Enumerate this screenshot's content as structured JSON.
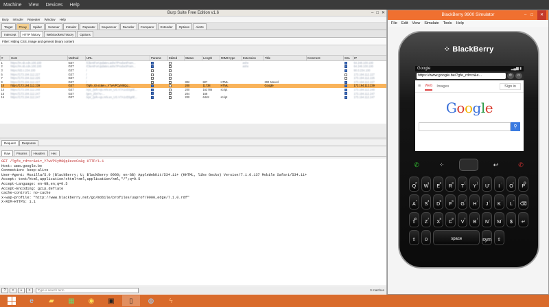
{
  "vbox_menu": [
    "Machine",
    "View",
    "Devices",
    "Help"
  ],
  "burp": {
    "title": "Burp Suite Free Edition v1.6",
    "menu": [
      "Burp",
      "Intruder",
      "Repeater",
      "Window",
      "Help"
    ],
    "main_tabs": [
      "Target",
      "Proxy",
      "Spider",
      "Scanner",
      "Intruder",
      "Repeater",
      "Sequencer",
      "Decoder",
      "Comparer",
      "Extender",
      "Options",
      "Alerts"
    ],
    "proxy_tabs": [
      "Intercept",
      "HTTP history",
      "WebSockets history",
      "Options"
    ],
    "filter": "Filter: Hiding CSS, image and general binary content",
    "columns": [
      "#",
      "Host",
      "Method",
      "URL",
      "Params",
      "Edited",
      "Status",
      "Length",
      "MIME type",
      "Extension",
      "Title",
      "Comment",
      "SSL",
      "IP"
    ],
    "rows": [
      {
        "num": "1",
        "host": "https://m.sb.cdn.100.100",
        "method": "GET",
        "url": "/ClientForUpdates.ashx?ProductFram...",
        "params": true,
        "edited": false,
        "status": "",
        "length": "",
        "mime": "",
        "ext": "ashx",
        "title": "",
        "ssl": true,
        "ip": "64.248.100.100"
      },
      {
        "num": "2",
        "host": "https://m.sb.cdn.100.100",
        "method": "GET",
        "url": "/ClientForUpdates.ashx?ProductFram...",
        "params": true,
        "edited": false,
        "status": "",
        "length": "",
        "mime": "",
        "ext": "ashx",
        "title": "",
        "ssl": true,
        "ip": "64.248.100.100"
      },
      {
        "num": "3",
        "host": "https://d2.c.234.100",
        "method": "GET",
        "url": "/",
        "params": false,
        "edited": false,
        "status": "",
        "length": "",
        "mime": "",
        "ext": "",
        "title": "",
        "ssl": true,
        "ip": "90.0.234.100"
      },
      {
        "num": "5",
        "host": "https://173.194.112.227",
        "method": "GET",
        "url": "/",
        "params": false,
        "edited": false,
        "status": "",
        "length": "",
        "mime": "",
        "ext": "",
        "title": "",
        "ssl": false,
        "ip": "173.194.112.227"
      },
      {
        "num": "7",
        "host": "https://173.194.112.226",
        "method": "GET",
        "url": "/",
        "params": false,
        "edited": false,
        "status": "",
        "length": "",
        "mime": "",
        "ext": "",
        "title": "",
        "ssl": false,
        "ip": "173.194.112.226"
      },
      {
        "num": "9",
        "host": "https://173.194.112.227",
        "method": "GET",
        "url": "/",
        "params": false,
        "edited": false,
        "status": "302",
        "length": "827",
        "mime": "HTML",
        "ext": "",
        "title": "302 Moved",
        "ssl": true,
        "ip": "173.194.112.227"
      },
      {
        "num": "10",
        "host": "https://173.194.112.239",
        "method": "GET",
        "url": "/?gfe_rd=cr&ei=_Y7wVPCyM8Qq...",
        "params": true,
        "edited": false,
        "status": "200",
        "length": "11738",
        "mime": "HTML",
        "ext": "",
        "title": "Google",
        "ssl": true,
        "ip": "173.194.112.239",
        "selected": true
      },
      {
        "num": "14",
        "host": "https://173.194.112.248",
        "method": "GET",
        "url": "/xjs/_/js/k=xjs.mhi.en_US.V7A1cE0g0E...",
        "params": true,
        "edited": false,
        "status": "200",
        "length": "163786",
        "mime": "script",
        "ext": "",
        "title": "",
        "ssl": true,
        "ip": "173.194.112.248"
      },
      {
        "num": "15",
        "host": "https://173.194.112.247",
        "method": "GET",
        "url": "/gen_204?s=...",
        "params": true,
        "edited": false,
        "status": "204",
        "length": "168",
        "mime": "",
        "ext": "",
        "title": "",
        "ssl": true,
        "ip": "173.194.112.247"
      },
      {
        "num": "16",
        "host": "https://173.194.112.247",
        "method": "GET",
        "url": "/xjs/_/js/k=xjs.mhi.en_US.V7A1cE0g0E...",
        "params": true,
        "edited": false,
        "status": "200",
        "length": "6448",
        "mime": "script",
        "ext": "",
        "title": "",
        "ssl": true,
        "ip": "173.194.112.247"
      }
    ],
    "req_tabs": [
      "Request",
      "Response"
    ],
    "raw_tabs": [
      "Raw",
      "Params",
      "Headers",
      "Hex"
    ],
    "request_lines": [
      {
        "text": "GET /?gfe_rd=cr&ei=_Y7wVPCyM8Qq8ezoCo&g HTTP/1.1",
        "hl": true
      },
      {
        "text": "Host: www.google.be",
        "hl": false
      },
      {
        "text": "Connection: keep-alive",
        "hl": false
      },
      {
        "text": "User-Agent: Mozilla/5.0 (BlackBerry; U; BlackBerry 9900; en-GB) AppleWebKit/534.11+ (KHTML, like Gecko) Version/7.1.0.137 Mobile Safari/534.11+",
        "hl": false
      },
      {
        "text": "Accept: text/html,application/xhtml+xml,application/xml,*/*;q=0.5",
        "hl": false
      },
      {
        "text": "Accept-Language: en-GB,en;q=0.5",
        "hl": false
      },
      {
        "text": "Accept-Encoding: gzip,deflate",
        "hl": false
      },
      {
        "text": "cache-control: no-cache",
        "hl": false
      },
      {
        "text": "x-wap-profile: \"http://www.blackberry.net/go/mobile/profiles/uaprof/9900_edge/7.1.0.rdf\"",
        "hl": false
      },
      {
        "text": "X-RIM-HTTPS: 1.1",
        "hl": false
      }
    ],
    "search_buttons": [
      "?",
      "<",
      "+",
      ">"
    ],
    "search_placeholder": "Type a search term",
    "matches": "0 matches"
  },
  "simulator": {
    "title": "BlackBerry 9900 Simulator",
    "menu": [
      "File",
      "Edit",
      "View",
      "Simulate",
      "Tools",
      "Help"
    ],
    "brand": "BlackBerry",
    "browser_title": "Google",
    "url": "https://www.google.be/?gfe_rd=cr&e...",
    "google_tabs": {
      "web": "Web",
      "images": "Images",
      "signin": "Sign in"
    },
    "google_logo": [
      "G",
      "o",
      "o",
      "g",
      "l",
      "e"
    ],
    "google_logo_colors": [
      "#3a6fd8",
      "#d8392b",
      "#f4b400",
      "#3a6fd8",
      "#2b9a46",
      "#d8392b"
    ],
    "keys": [
      {
        "main": "Q",
        "alt": "#"
      },
      {
        "main": "W",
        "alt": "1"
      },
      {
        "main": "E",
        "alt": "2"
      },
      {
        "main": "R",
        "alt": "3"
      },
      {
        "main": "T",
        "alt": "("
      },
      {
        "main": "Y",
        "alt": ")"
      },
      {
        "main": "U",
        "alt": "_"
      },
      {
        "main": "I",
        "alt": "-"
      },
      {
        "main": "O",
        "alt": "+"
      },
      {
        "main": "P",
        "alt": "@"
      },
      {
        "main": "A",
        "alt": "*"
      },
      {
        "main": "S",
        "alt": "4"
      },
      {
        "main": "D",
        "alt": "5"
      },
      {
        "main": "F",
        "alt": "6"
      },
      {
        "main": "G",
        "alt": "/"
      },
      {
        "main": "H",
        "alt": ":"
      },
      {
        "main": "J",
        "alt": ";"
      },
      {
        "main": "K",
        "alt": "'"
      },
      {
        "main": "L",
        "alt": "\""
      },
      {
        "main": "⌫",
        "alt": ""
      },
      {
        "main": "⇧",
        "alt": "alt"
      },
      {
        "main": "Z",
        "alt": "7"
      },
      {
        "main": "X",
        "alt": "8"
      },
      {
        "main": "C",
        "alt": "9"
      },
      {
        "main": "V",
        "alt": "?"
      },
      {
        "main": "B",
        "alt": "!"
      },
      {
        "main": "N",
        "alt": ","
      },
      {
        "main": "M",
        "alt": "."
      },
      {
        "main": "$",
        "alt": ""
      },
      {
        "main": "↵",
        "alt": ""
      },
      {
        "main": "⇧",
        "alt": ""
      },
      {
        "main": "0",
        "alt": ""
      },
      {
        "main": "space",
        "alt": "",
        "wide": true
      },
      {
        "main": "sym",
        "alt": ""
      },
      {
        "main": "⇧",
        "alt": ""
      }
    ]
  },
  "taskbar": [
    "windows",
    "ie",
    "explorer",
    "store",
    "chrome",
    "cmd",
    "simulator",
    "globe",
    "burp"
  ]
}
